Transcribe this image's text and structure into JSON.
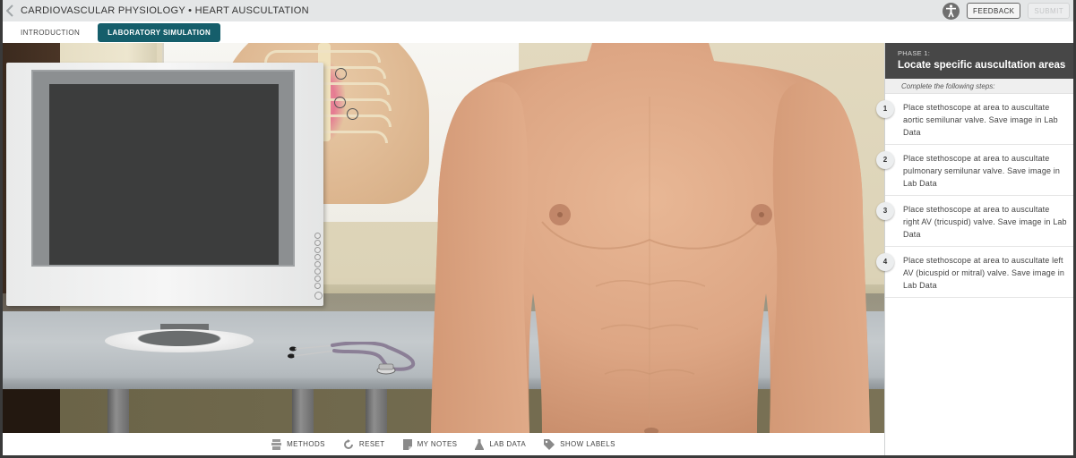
{
  "header": {
    "title": "CARDIOVASCULAR PHYSIOLOGY • HEART AUSCULTATION",
    "back_icon": "chevron-left-icon",
    "accessibility_icon": "accessibility-icon",
    "feedback_label": "FEEDBACK",
    "submit_label": "SUBMIT"
  },
  "tabs": [
    {
      "label": "INTRODUCTION",
      "active": false
    },
    {
      "label": "LABORATORY SIMULATION",
      "active": true
    }
  ],
  "scene": {
    "auscultation_markers": [
      "aortic-area",
      "pulmonic-area",
      "tricuspid-area",
      "mitral-area"
    ],
    "objects": [
      "monitor",
      "stethoscope",
      "anatomy-poster",
      "patient-torso"
    ]
  },
  "toolbar": {
    "items": [
      {
        "label": "METHODS",
        "icon": "methods-icon"
      },
      {
        "label": "RESET",
        "icon": "reset-icon"
      },
      {
        "label": "MY NOTES",
        "icon": "notes-icon"
      },
      {
        "label": "LAB DATA",
        "icon": "flask-icon"
      },
      {
        "label": "SHOW LABELS",
        "icon": "tag-icon"
      }
    ]
  },
  "sidebar": {
    "phase_label": "PHASE 1:",
    "phase_title": "Locate specific auscultation areas",
    "intro": "Complete the following steps:",
    "steps": [
      {
        "num": "1",
        "text": "Place stethoscope at area to auscultate aortic semilunar valve. Save image in Lab Data"
      },
      {
        "num": "2",
        "text": "Place stethoscope at area to auscultate pulmonary semilunar valve. Save image in Lab Data"
      },
      {
        "num": "3",
        "text": "Place stethoscope at area to auscultate right AV (tricuspid) valve. Save image in Lab Data"
      },
      {
        "num": "4",
        "text": "Place stethoscope at area to auscultate left AV (bicuspid or mitral) valve. Save image in Lab Data"
      }
    ]
  },
  "colors": {
    "accent": "#155e6b",
    "phase_header": "#474747",
    "title_bar": "#e4e6e7"
  }
}
